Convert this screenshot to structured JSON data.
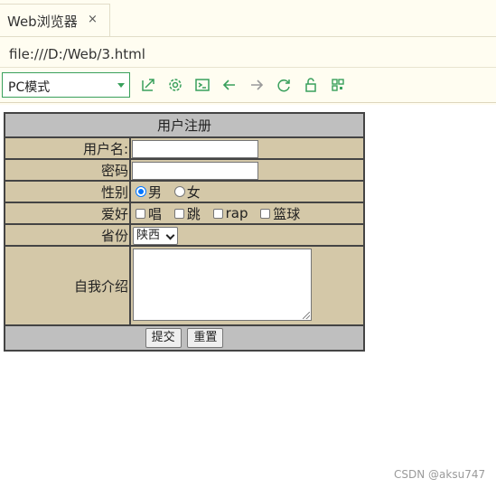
{
  "browser": {
    "tab_title": "Web浏览器",
    "tab_close": "×",
    "url": "file:///D:/Web/3.html",
    "mode": "PC模式",
    "accent": "#39a05c",
    "toolbar_icons": [
      "open-external-icon",
      "settings-icon",
      "terminal-icon",
      "back-arrow-icon",
      "forward-arrow-icon",
      "refresh-icon",
      "unlock-icon",
      "qr-code-icon"
    ]
  },
  "form": {
    "title": "用户注册",
    "username_label": "用户名:",
    "password_label": "密码",
    "gender_label": "性别",
    "gender_male": "男",
    "gender_female": "女",
    "gender_selected": "男",
    "hobby_label": "爱好",
    "hobbies": [
      "唱",
      "跳",
      "rap",
      "篮球"
    ],
    "province_label": "省份",
    "province_selected": "陕西",
    "intro_label": "自我介绍",
    "submit": "提交",
    "reset": "重置",
    "label_bg": "#d4c8a8",
    "header_bg": "#bfbfbf"
  },
  "watermark": "CSDN @aksu747"
}
